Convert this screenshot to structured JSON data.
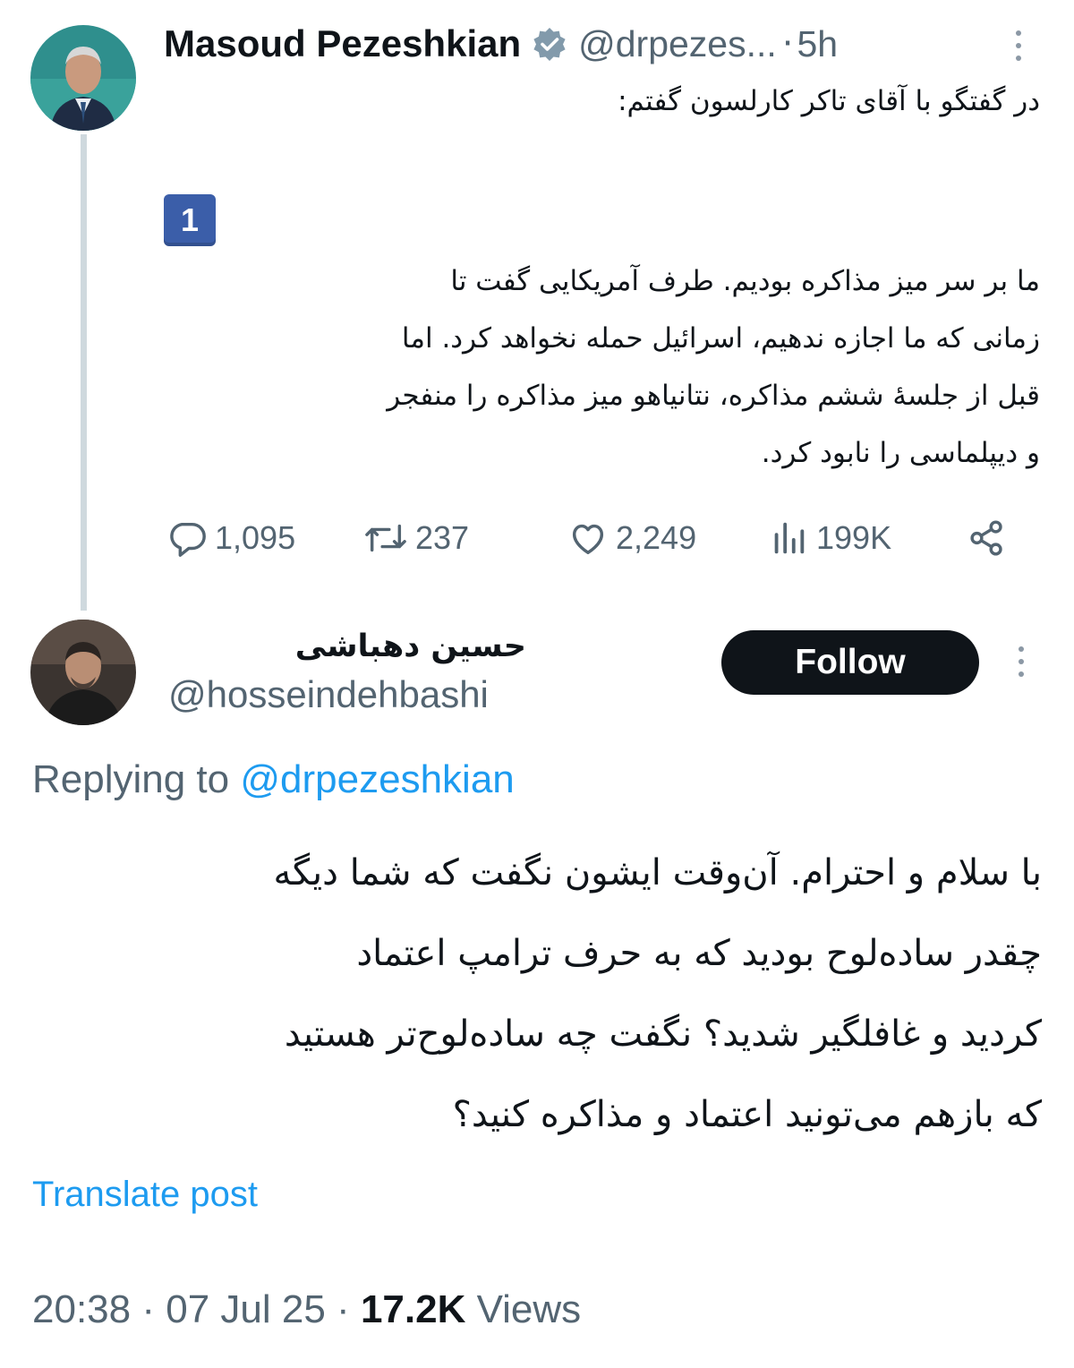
{
  "original_tweet": {
    "author_name": "Masoud Pezeshkian",
    "handle": "@drpezes...",
    "separator": "·",
    "time_ago": "5h",
    "intro_text": "در گفتگو با آقای تاکر کارلسون گفتم:",
    "number_badge": "1",
    "body_lines": [
      "ما بر سر میز مذاکره بودیم. طرف آمریکایی گفت تا",
      "زمانی که ما اجازه ندهیم، اسرائیل حمله نخواهد کرد. اما",
      "قبل از جلسهٔ ششم مذاکره، نتانیاهو میز مذاکره را منفجر",
      "و دیپلماسی را نابود کرد."
    ],
    "stats": {
      "replies": "1,095",
      "reposts": "237",
      "likes": "2,249",
      "views": "199K"
    },
    "icons": [
      "verified-badge-icon",
      "more-icon",
      "reply-icon",
      "repost-icon",
      "like-icon",
      "views-icon",
      "share-icon"
    ]
  },
  "reply_tweet": {
    "author_name": "حسین دهباشی",
    "handle": "@hosseindehbashi",
    "follow_label": "Follow",
    "replying_prefix": "Replying to",
    "replying_mention": "@drpezeshkian",
    "body_lines": [
      "با سلام و احترام. آن‌وقت ایشون نگفت که شما دیگه",
      "چقدر ساده‌لوح بودید که به حرف ترامپ اعتماد",
      "کردید و غافلگیر شدید؟ نگفت چه ساده‌لوح‌تر هستید",
      "که بازهم می‌تونید اعتماد و مذاکره کنید؟"
    ],
    "translate_label": "Translate post",
    "time": "20:38",
    "date": "07 Jul 25",
    "separator": "·",
    "views_count": "17.2K",
    "views_label": "Views"
  },
  "colors": {
    "text": "#0f1419",
    "secondary": "#536471",
    "link": "#1d9bf0",
    "thread_line": "#cfd9de",
    "follow_bg": "#0f1419",
    "badge_bg": "#3b5ea9"
  }
}
